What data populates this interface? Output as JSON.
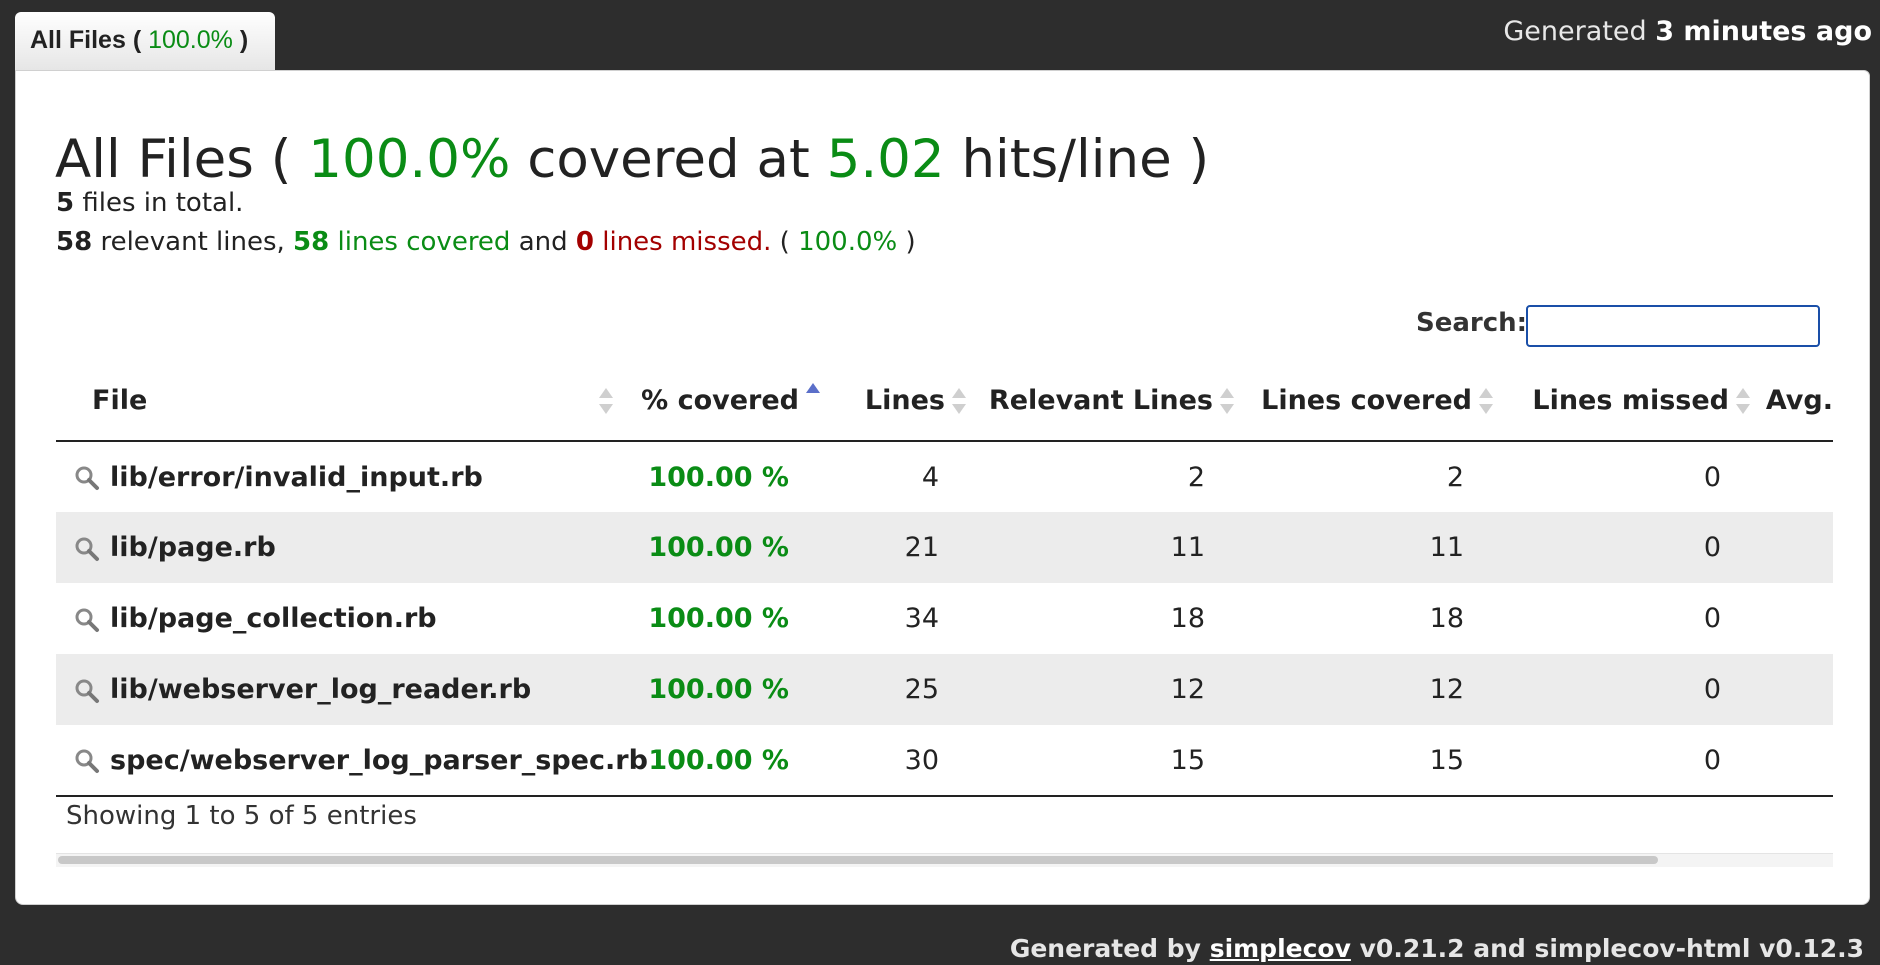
{
  "tab": {
    "label": "All Files",
    "pct": "100.0%"
  },
  "generated": {
    "prefix": "Generated",
    "when": "3 minutes ago"
  },
  "heading": {
    "prefix": "All Files (",
    "pct": "100.0%",
    "mid": "covered at",
    "hits": "5.02",
    "suffix": "hits/line )"
  },
  "summary": {
    "files_count": "5",
    "files_text": "files in total.",
    "relevant": "58",
    "relevant_text": "relevant lines,",
    "covered": "58",
    "covered_text": "lines covered",
    "and_text": "and",
    "missed": "0",
    "missed_text": "lines missed.",
    "pct": "100.0%"
  },
  "search": {
    "label": "Search:",
    "value": "",
    "placeholder": ""
  },
  "table": {
    "columns": [
      "File",
      "% covered",
      "Lines",
      "Relevant Lines",
      "Lines covered",
      "Lines missed",
      "Avg."
    ],
    "rows": [
      {
        "file": "lib/error/invalid_input.rb",
        "covered_pct": "100.00 %",
        "lines": "4",
        "relevant": "2",
        "covered": "2",
        "missed": "0"
      },
      {
        "file": "lib/page.rb",
        "covered_pct": "100.00 %",
        "lines": "21",
        "relevant": "11",
        "covered": "11",
        "missed": "0"
      },
      {
        "file": "lib/page_collection.rb",
        "covered_pct": "100.00 %",
        "lines": "34",
        "relevant": "18",
        "covered": "18",
        "missed": "0"
      },
      {
        "file": "lib/webserver_log_reader.rb",
        "covered_pct": "100.00 %",
        "lines": "25",
        "relevant": "12",
        "covered": "12",
        "missed": "0"
      },
      {
        "file": "spec/webserver_log_parser_spec.rb",
        "covered_pct": "100.00 %",
        "lines": "30",
        "relevant": "15",
        "covered": "15",
        "missed": "0"
      }
    ]
  },
  "info": "Showing 1 to 5 of 5 entries",
  "footer": {
    "prefix": "Generated by",
    "link": "simplecov",
    "suffix": "v0.21.2 and simplecov-html v0.12.3"
  },
  "colors": {
    "green": "#0a8c15",
    "red": "#a30000",
    "background": "#2d2d2d"
  },
  "icons": {
    "file": "magnifier-icon",
    "sort": "sort-arrows-icon",
    "sort_active": "sort-asc-icon"
  }
}
